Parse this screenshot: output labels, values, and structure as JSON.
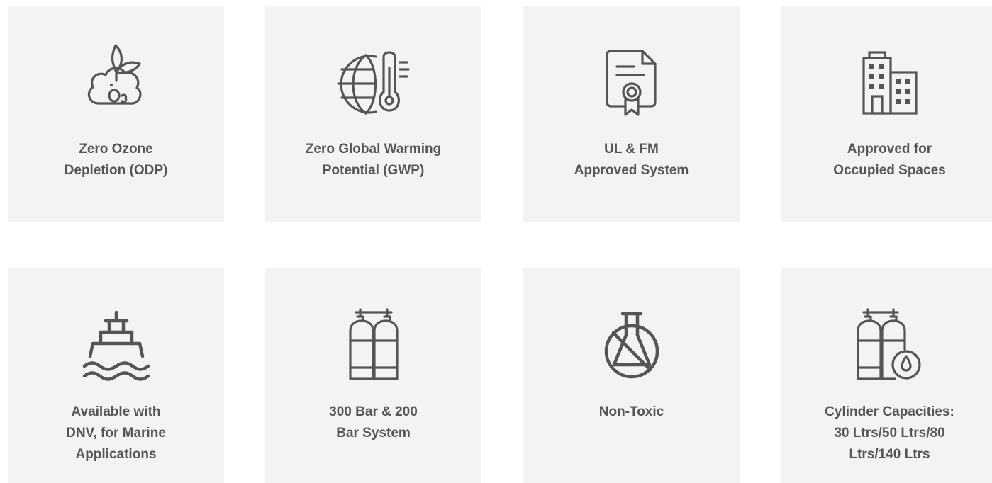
{
  "features": [
    {
      "icon": "ozone-leaf-icon",
      "lines": [
        "Zero Ozone",
        "Depletion (ODP)"
      ]
    },
    {
      "icon": "globe-thermometer-icon",
      "lines": [
        "Zero Global Warming",
        "Potential (GWP)"
      ]
    },
    {
      "icon": "certificate-icon",
      "lines": [
        "UL & FM",
        "Approved System"
      ]
    },
    {
      "icon": "buildings-icon",
      "lines": [
        "Approved for",
        "Occupied Spaces"
      ]
    },
    {
      "icon": "ship-icon",
      "lines": [
        "Available with",
        "DNV, for Marine",
        "Applications"
      ]
    },
    {
      "icon": "gas-cylinders-icon",
      "lines": [
        "300 Bar & 200",
        "Bar System"
      ]
    },
    {
      "icon": "non-toxic-flask-icon",
      "lines": [
        "Non-Toxic"
      ]
    },
    {
      "icon": "cylinders-drop-icon",
      "lines": [
        "Cylinder Capacities:",
        "30 Ltrs/50 Ltrs/80",
        "Ltrs/140 Ltrs"
      ]
    }
  ],
  "colors": {
    "card_background": "#f3f3f3",
    "icon_stroke": "#555555",
    "text": "#555555"
  }
}
